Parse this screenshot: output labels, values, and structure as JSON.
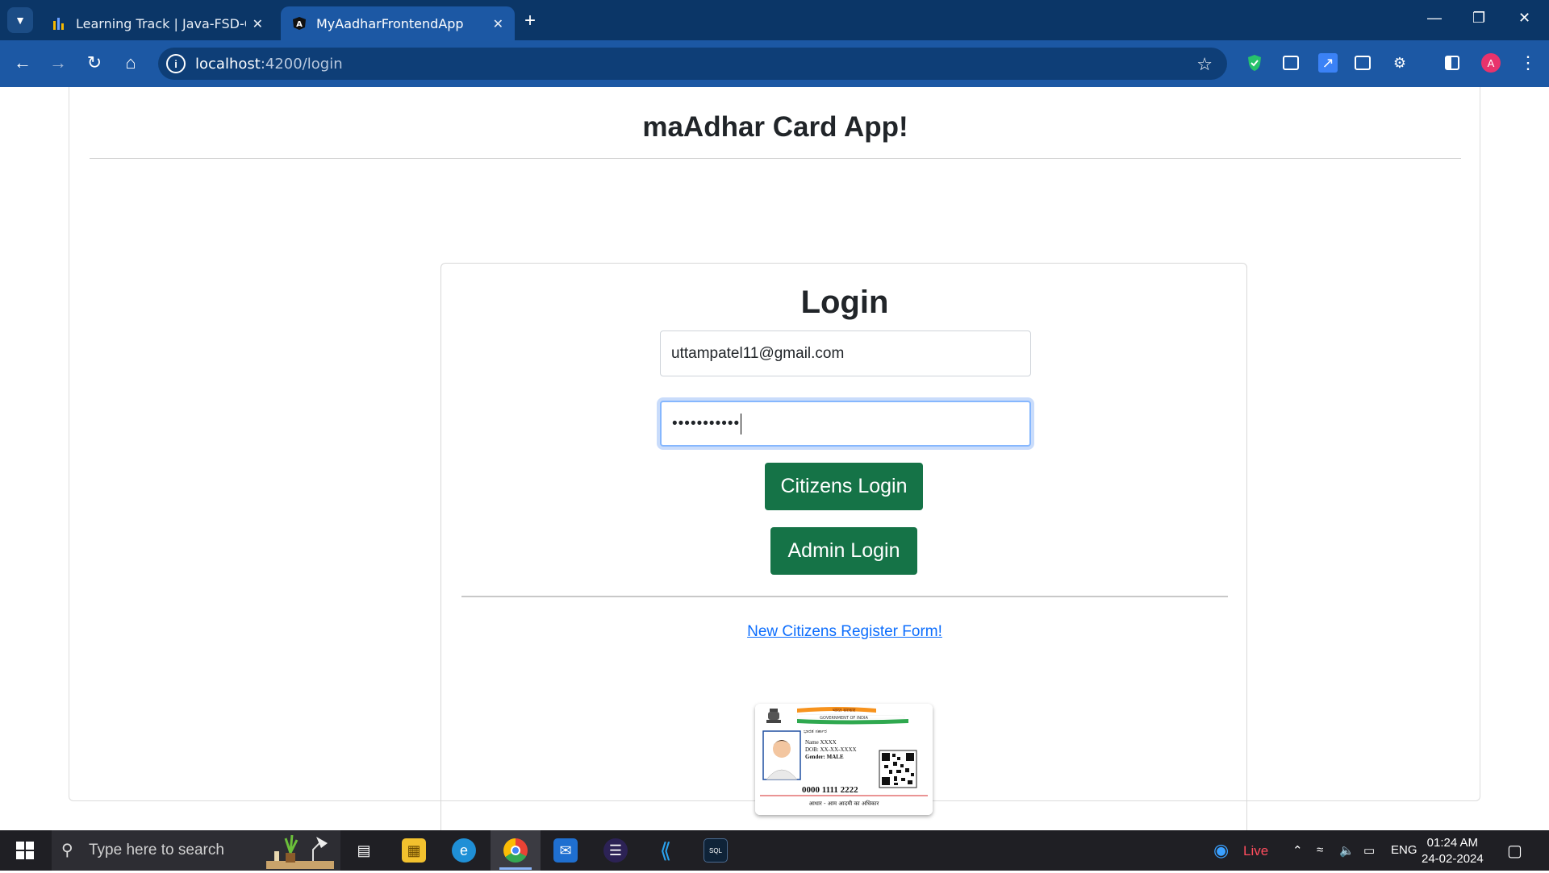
{
  "browser": {
    "tabs": [
      {
        "title": "Learning Track | Java-FSD-Capst",
        "active": false
      },
      {
        "title": "MyAadharFrontendApp",
        "active": true
      }
    ],
    "url_host": "localhost",
    "url_rest": ":4200/login"
  },
  "page": {
    "app_title": "maAdhar Card App!",
    "login_heading": "Login",
    "email_value": "uttampatel11@gmail.com",
    "password_mask": "•••••••••••",
    "citizens_login": "Citizens Login",
    "admin_login": "Admin Login",
    "register_link": "New Citizens Register Form!"
  },
  "aadhaar_card": {
    "header_hi": "भारत सरकार",
    "header_en": "GOVERNMENT OF INDIA",
    "local_script": "ಭಾರತ ಸರ್ಕಾರ",
    "name": "Name XXXX",
    "dob": "DOB: XX-XX-XXXX",
    "gender": "Gender: MALE",
    "number": "0000 1111 2222",
    "footer": "आधार - आम आदमी का अधिकार"
  },
  "taskbar": {
    "search_placeholder": "Type here to search",
    "news_label": "Live",
    "lang": "ENG",
    "time": "01:24 AM",
    "date": "24-02-2024"
  },
  "colors": {
    "tabstrip": "#0b3667",
    "toolbar": "#1c58a4",
    "button_green": "#157347",
    "link_blue": "#0d6efd"
  }
}
